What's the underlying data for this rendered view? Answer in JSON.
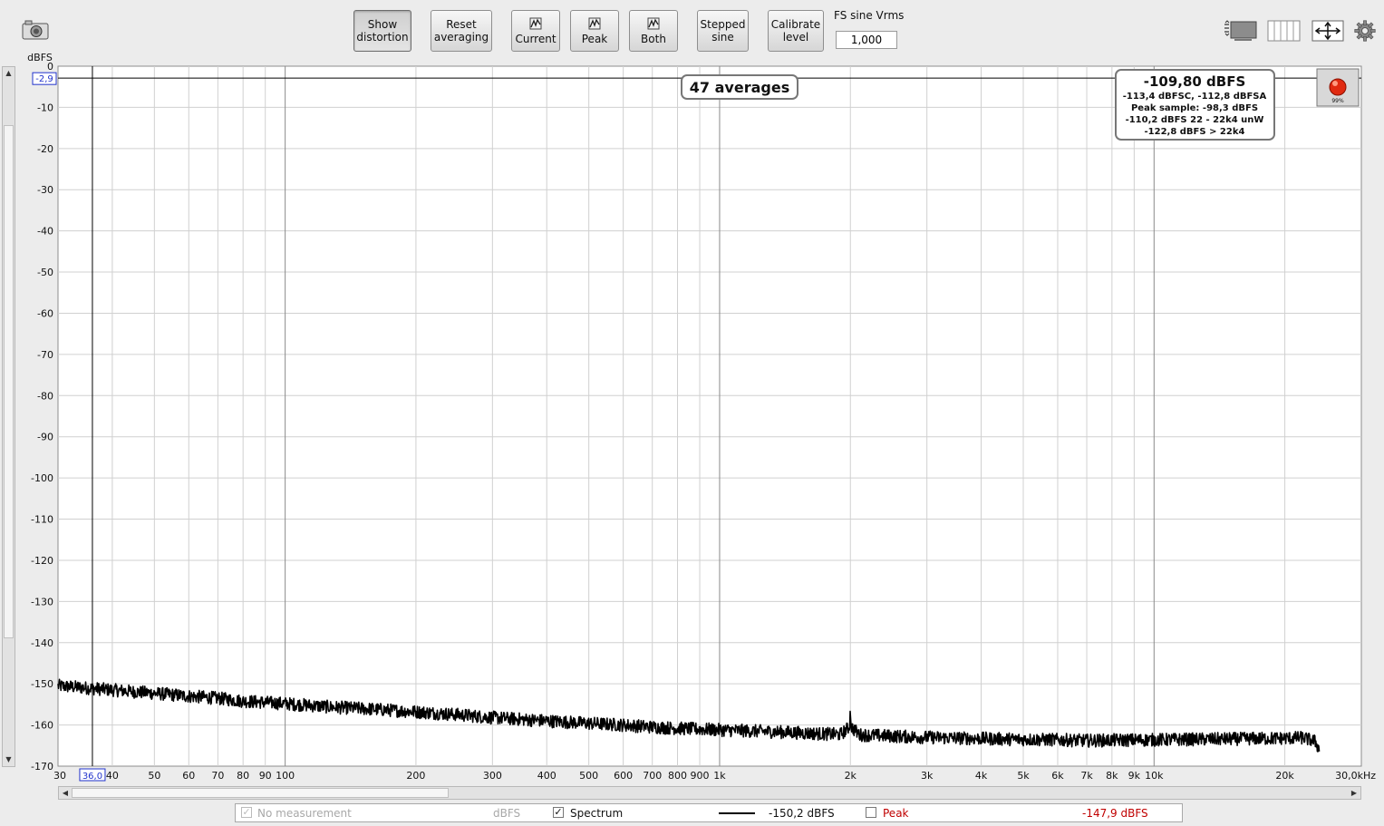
{
  "toolbar": {
    "camera_icon": "camera-icon",
    "buttons": [
      {
        "label": "Show\ndistortion",
        "pressed": true
      },
      {
        "label": "Reset\naveraging",
        "pressed": false
      },
      {
        "label": "Current",
        "icon": "trace-icon",
        "pressed": false
      },
      {
        "label": "Peak",
        "icon": "trace-icon",
        "pressed": false
      },
      {
        "label": "Both",
        "icon": "trace-icon",
        "pressed": false
      },
      {
        "label": "Stepped\nsine",
        "pressed": false
      },
      {
        "label": "Calibrate\nlevel",
        "pressed": false
      }
    ],
    "fs_label": "FS sine Vrms",
    "fs_value": "1,000",
    "right_icons": [
      "graph-layout-icon",
      "columns-icon",
      "fit-arrows-icon",
      "gear-icon"
    ]
  },
  "chart_data": {
    "type": "line",
    "title": "",
    "ylabel": "dBFS",
    "xlabel": "",
    "x_unit_label": "30,0kHz",
    "x_scale": "log",
    "xlim": [
      30,
      30000
    ],
    "ylim": [
      -170,
      0
    ],
    "grid": true,
    "y_ticks": [
      0,
      -10,
      -20,
      -30,
      -40,
      -50,
      -60,
      -70,
      -80,
      -90,
      -100,
      -110,
      -120,
      -130,
      -140,
      -150,
      -160,
      -170
    ],
    "x_ticks": [
      {
        "v": 30,
        "label": "30"
      },
      {
        "v": 40,
        "label": "40"
      },
      {
        "v": 50,
        "label": "50"
      },
      {
        "v": 60,
        "label": "60"
      },
      {
        "v": 70,
        "label": "70"
      },
      {
        "v": 80,
        "label": "80"
      },
      {
        "v": 90,
        "label": "90"
      },
      {
        "v": 100,
        "label": "100"
      },
      {
        "v": 200,
        "label": "200"
      },
      {
        "v": 300,
        "label": "300"
      },
      {
        "v": 400,
        "label": "400"
      },
      {
        "v": 500,
        "label": "500"
      },
      {
        "v": 600,
        "label": "600"
      },
      {
        "v": 700,
        "label": "700"
      },
      {
        "v": 800,
        "label": "800"
      },
      {
        "v": 900,
        "label": "900"
      },
      {
        "v": 1000,
        "label": "1k"
      },
      {
        "v": 2000,
        "label": "2k"
      },
      {
        "v": 3000,
        "label": "3k"
      },
      {
        "v": 4000,
        "label": "4k"
      },
      {
        "v": 5000,
        "label": "5k"
      },
      {
        "v": 6000,
        "label": "6k"
      },
      {
        "v": 7000,
        "label": "7k"
      },
      {
        "v": 8000,
        "label": "8k"
      },
      {
        "v": 9000,
        "label": "9k"
      },
      {
        "v": 10000,
        "label": "10k"
      },
      {
        "v": 20000,
        "label": "20k"
      }
    ],
    "cursor": {
      "x": 36.0,
      "y": -2.9,
      "x_label": "36,0",
      "y_label": "-2,9"
    },
    "series": [
      {
        "name": "Spectrum",
        "color": "#000000",
        "x": [
          30,
          35,
          40,
          50,
          60,
          70,
          80,
          100,
          130,
          150,
          200,
          250,
          300,
          400,
          500,
          600,
          700,
          800,
          1000,
          1300,
          1600,
          1900,
          1990,
          2000,
          2010,
          2100,
          2500,
          3000,
          4000,
          5000,
          6000,
          7000,
          8000,
          10000,
          12000,
          15000,
          20000,
          22000,
          23500,
          24000
        ],
        "y": [
          -150.5,
          -151,
          -151.5,
          -152.3,
          -153,
          -153.5,
          -154.2,
          -154.8,
          -155.7,
          -156,
          -156.8,
          -157.5,
          -158.2,
          -159,
          -159.6,
          -160,
          -160.5,
          -160.8,
          -161.2,
          -161.6,
          -162,
          -162.3,
          -160.5,
          -156.5,
          -160.5,
          -162.4,
          -162.7,
          -163,
          -163.3,
          -163.5,
          -163.6,
          -163.8,
          -163.7,
          -163.6,
          -163.5,
          -163.4,
          -163.2,
          -163.1,
          -164,
          -166
        ]
      }
    ]
  },
  "overlay": {
    "averages": "47 averages",
    "level_main": "-109,80 dBFS",
    "level_lines": [
      "-113,4 dBFSC, -112,8 dBFSA",
      "Peak sample: -98,3 dBFS",
      "-110,2 dBFS 22 - 22k4 unW",
      "-122,8 dBFS > 22k4"
    ],
    "rec_percent": "99%"
  },
  "legend": {
    "no_measurement": "No measurement",
    "unit1": "dBFS",
    "spectrum_label": "Spectrum",
    "spectrum_value": "-150,2 dBFS",
    "peak_label": "Peak",
    "peak_value": "-147,9 dBFS",
    "peak_color": "#c00000"
  }
}
